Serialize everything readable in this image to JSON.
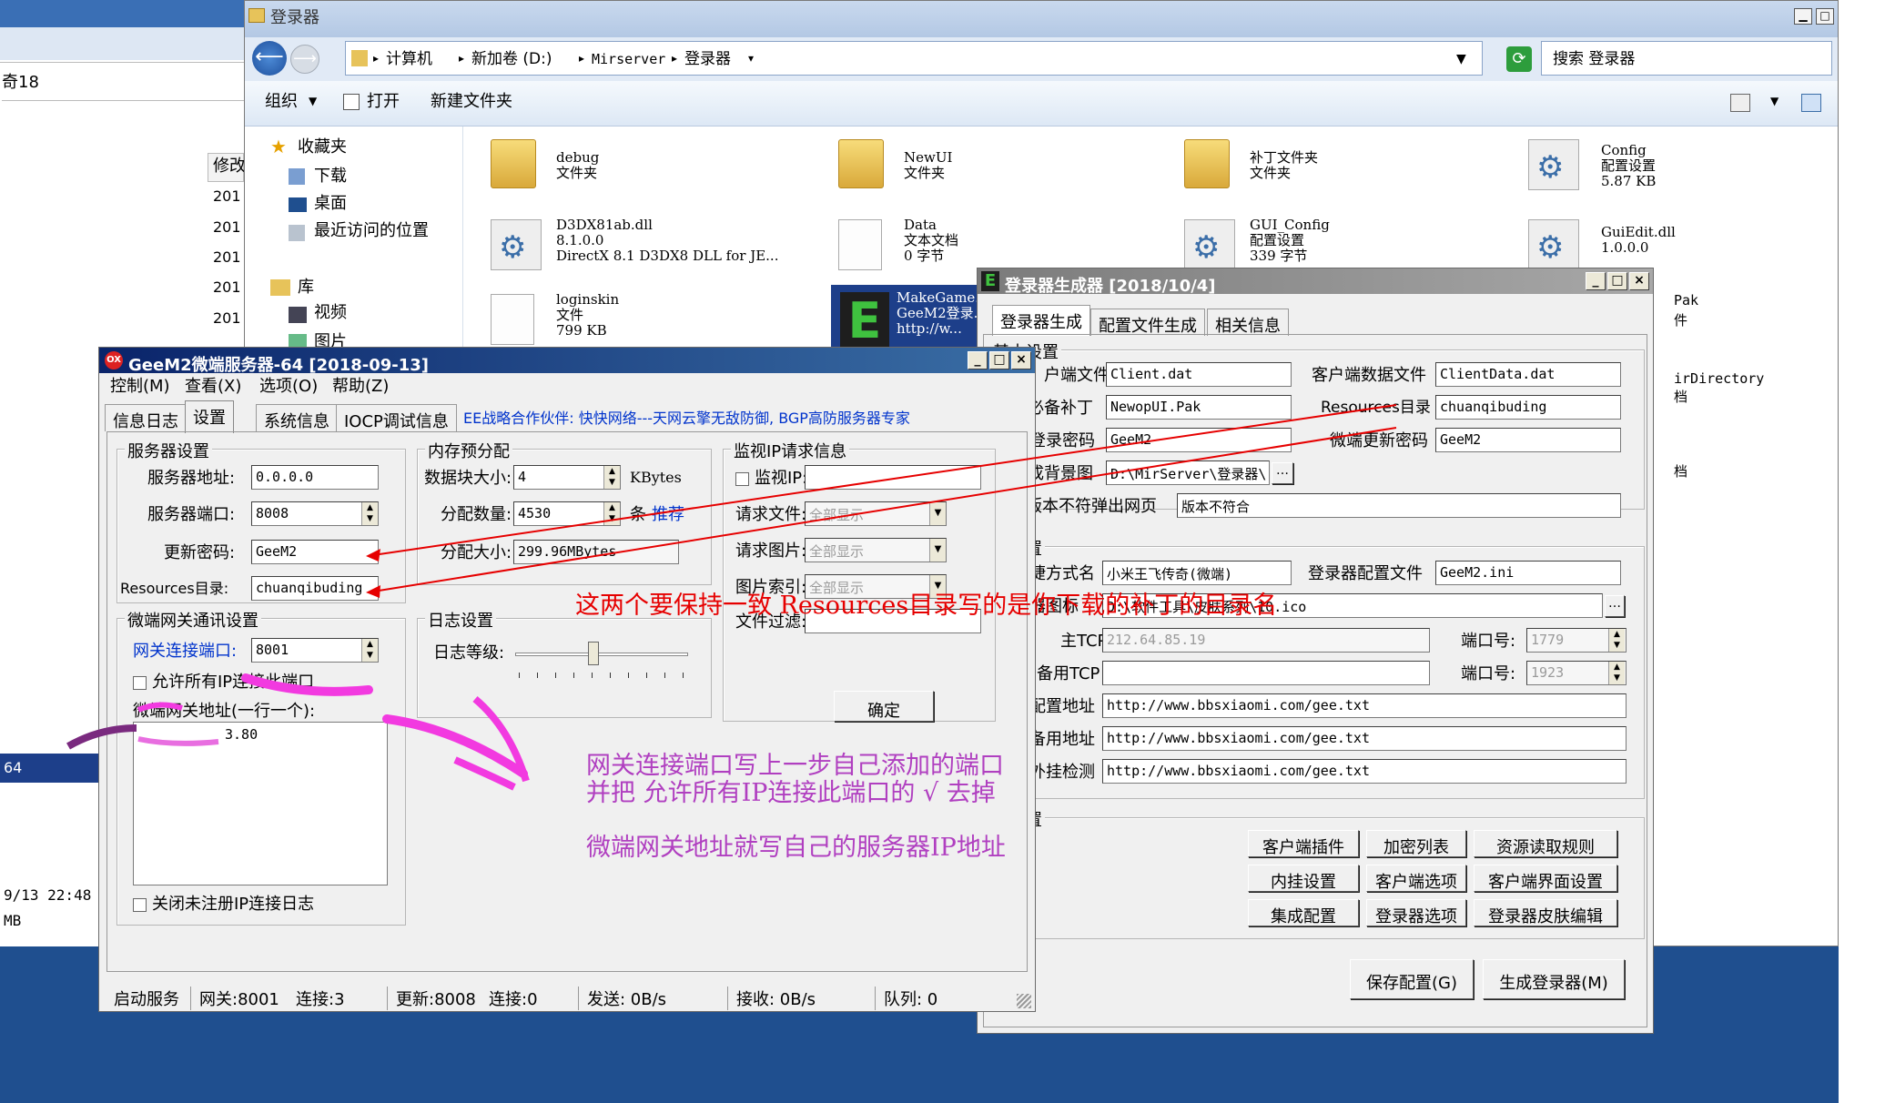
{
  "explorer": {
    "title": "登录器",
    "breadcrumb": [
      "计算机",
      "新加卷 (D:)",
      "Mirserver",
      "登录器"
    ],
    "search_placeholder": "搜索 登录器",
    "toolbar": {
      "organize": "组织",
      "open": "打开",
      "new_folder": "新建文件夹"
    },
    "nav": {
      "favorites": "收藏夹",
      "download": "下载",
      "desktop": "桌面",
      "recent": "最近访问的位置",
      "library": "库",
      "video": "视频",
      "pictures": "图片"
    },
    "left_strip": {
      "label": "奇18",
      "col_header": "修改",
      "years": [
        "201",
        "201",
        "201",
        "201",
        "201"
      ],
      "item_64": "64",
      "timestamp": "9/13 22:48",
      "mb": "MB"
    },
    "files": [
      {
        "name": "debug",
        "type": "文件夹",
        "extra": ""
      },
      {
        "name": "NewUI",
        "type": "文件夹",
        "extra": ""
      },
      {
        "name": "补丁文件夹",
        "type": "文件夹",
        "extra": ""
      },
      {
        "name": "Config",
        "type": "配置设置",
        "extra": "5.87 KB"
      },
      {
        "name": "D3DX81ab.dll",
        "type": "8.1.0.0",
        "extra": "DirectX 8.1 D3DX8 DLL for JE..."
      },
      {
        "name": "Data",
        "type": "文本文档",
        "extra": "0 字节"
      },
      {
        "name": "GUI_Config",
        "type": "配置设置",
        "extra": "339 字节"
      },
      {
        "name": "GuiEdit.dll",
        "type": "1.0.0.0",
        "extra": ""
      },
      {
        "name": "loginskin",
        "type": "文件",
        "extra": "799 KB"
      },
      {
        "name": "MakeGame...",
        "type": "GeeM2登录...",
        "extra": "http://w..."
      }
    ],
    "partial_right": [
      "Pak",
      "件",
      "irDirectory",
      "档",
      "档"
    ]
  },
  "server": {
    "title": "GeeM2微端服务器-64 [2018-09-13]",
    "menu": [
      "控制(M)",
      "查看(X)",
      "选项(O)",
      "帮助(Z)"
    ],
    "tabs": [
      "信息日志",
      "设置",
      "系统信息",
      "IOCP调试信息"
    ],
    "partner": "EE战略合作伙伴: 快快网络---天网云擎无敌防御, BGP高防服务器专家",
    "server_group": "服务器设置",
    "addr_label": "服务器地址:",
    "addr": "0.0.0.0",
    "port_label": "服务器端口:",
    "port": "8008",
    "pwd_label": "更新密码:",
    "pwd": "GeeM2",
    "res_label": "Resources目录:",
    "res": "chuanqibuding",
    "mem_group": "内存预分配",
    "block_label": "数据块大小:",
    "block": "4",
    "block_unit": "KBytes",
    "count_label": "分配数量:",
    "count": "4530",
    "count_unit": "条",
    "recommend": "推荐",
    "size_label": "分配大小:",
    "size": "299.96MBytes",
    "mon_group": "监视IP请求信息",
    "mon_ip": "监视IP:",
    "req_file": "请求文件:",
    "req_pic": "请求图片:",
    "pic_idx": "图片索引:",
    "file_filter": "文件过滤:",
    "all_show": "全部显示",
    "gw_group": "微端网关通讯设置",
    "gw_port_label": "网关连接端口:",
    "gw_port": "8001",
    "allow_all": "允许所有IP连接此端口",
    "gw_addr_label": "微端网关地址(一行一个):",
    "gw_addr_value": "3.80",
    "log_group": "日志设置",
    "log_level": "日志等级:",
    "ok": "确定",
    "close_log": "关闭未注册IP连接日志",
    "status": [
      "启动服务",
      "网关:8001",
      "连接:3",
      "更新:8008",
      "连接:0",
      "发送: 0B/s",
      "接收: 0B/s",
      "队列: 0"
    ]
  },
  "gen": {
    "title": "登录器生成器 [2018/10/4]",
    "tabs": [
      "登录器生成",
      "配置文件生成",
      "相关信息"
    ],
    "basic_group": "基本设置",
    "client_file_label": "户端文件",
    "client_file": "Client.dat",
    "client_data_label": "客户端数据文件",
    "client_data": "ClientData.dat",
    "patch_label": "必备补丁",
    "patch": "NewopUI.Pak",
    "res_label": "Resources目录",
    "res": "chuanqibuding",
    "login_pwd_label": "登录密码",
    "login_pwd": "GeeM2",
    "update_pwd_label": "微端更新密码",
    "update_pwd": "GeeM2",
    "bg_label": "成背景图",
    "bg": "D:\\MirServer\\登录器\\...",
    "ver_label": "版本不符弹出网页",
    "ver": "版本不符合",
    "launcher_group": "器设置",
    "shortcut_label": "捷方式名",
    "shortcut": "小米王飞传奇(微端)",
    "cfg_label": "登录器配置文件",
    "cfg": "GeeM2.ini",
    "skin_label": "器图标",
    "skin": "D:\\软件工具\\皮肤系列\\10.ico",
    "main_tcp_label": "主TCP",
    "main_tcp": "212.64.85.19",
    "port_label": "端口号:",
    "main_port": "1779",
    "bak_tcp_label": "备用TCP",
    "bak_tcp": "",
    "bak_port": "1923",
    "cfg_addr_label": "配置地址",
    "cfg_addr": "http://www.bbsxiaomi.com/gee.txt",
    "bak_addr_label": "备用地址",
    "bak_addr": "http://www.bbsxiaomi.com/gee.txt",
    "plug_label": "外挂检测",
    "plug": "http://www.bbsxiaomi.com/gee.txt",
    "other_group": "他设置",
    "buttons": [
      "客户端插件",
      "加密列表",
      "资源读取规则",
      "内挂设置",
      "客户端选项",
      "客户端界面设置",
      "集成配置",
      "登录器选项",
      "登录器皮肤编辑"
    ],
    "save": "保存配置(G)",
    "generate": "生成登录器(M)"
  },
  "annotations": {
    "keep_same": "这两个要保持一致 Resources目录写的是你下载的补丁的目录名",
    "gw_note1": "网关连接端口写上一步自己添加的端口",
    "gw_note2": "并把 允许所有IP连接此端口的 √ 去掉",
    "gw_note3": "微端网关地址就写自己的服务器IP地址"
  },
  "colors": {
    "red": "#e60000",
    "purple": "#b03fc0",
    "desktop": "#1f4f8f",
    "blue_title": "#0a2a6e"
  }
}
